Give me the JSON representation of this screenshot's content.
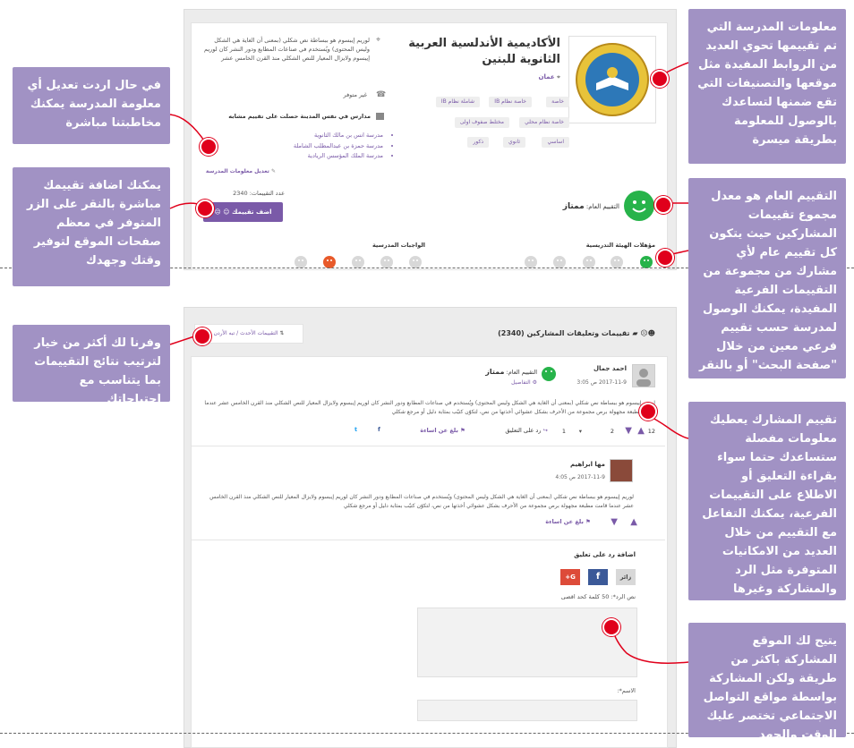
{
  "callouts": {
    "school_info": "معلومات المدرسة التي تم تقييمها تحوي العديد من الروابط المفيدة مثل موقعها والتصنيفات التي تقع ضمنها لتساعدك بالوصول للمعلومة بطريقة ميسرة",
    "overall_rating": "التقييم العام هو معدل مجموع تقييمات المشاركين حيث يتكون كل تقييم عام لأي مشارك من مجموعة من التقييمات الفرعية المفيدة، يمكنك الوصول لمدرسة حسب تقييم فرعي معين من خلال \"صفحة البحث\" أو بالنقر على \"تصفح\"",
    "participant_rating": "تقييم المشارك يعطيك معلومات مفصلة ستساعدك حتما سواء بقراءة التعليق أو الاطلاع على التقييمات الفرعية، يمكنك التفاعل مع التقييم من خلال العديد من الامكانيات المتوفرة مثل الرد والمشاركة وغيرها",
    "social_share": "يتيح لك الموقع المشاركة باكثر من طريقة ولكن المشاركة بواسطة مواقع التواصل الاجتماعي تختصر عليك الوقت والجهد",
    "edit_info": "في حال اردت تعديل أي معلومة المدرسة يمكنك مخاطبتنا مباشرة",
    "add_rating": "يمكنك اضافة تقييمك مباشرة بالنقر على الزر المتوفر في معظم صفحات الموقع لتوفير وقتك وجهدك",
    "sort": "وفرنا لك أكثر من خيار لترتيب نتائج التقييمات بما يتناسب مع احتياجاتك"
  },
  "school": {
    "name": "الأكاديمية الأندلسية العربية الثانوية للبنين",
    "location": "عمان",
    "tags_row1": [
      "خاصة",
      "خاصة نظام IB",
      "شاملة نظام IB"
    ],
    "tags_row2": [
      "خاصة نظام محلي",
      "مختلط صفوف اولى"
    ],
    "tags_row3": [
      "اساسي",
      "ثانوي",
      "ذكور"
    ],
    "description": "لوريم إيبسوم هو ببساطة نص شكلي (بمعنى أن الغاية هي الشكل وليس المحتوى) ويُستخدم في صناعات المطابع ودور النشر كان لوريم إيبسوم ولايزال المعيار للنص الشكلي منذ القرن الخامس عشر",
    "phone": "غير متوفر",
    "similar_title": "مدارس في نفس المدينة حصلت على تقييم مشابه",
    "similar": [
      "مدرسة انس بن مالك الثانوية",
      "مدرسة حمزة بن عبدالمطلب الشاملة",
      "مدرسة الملك المؤسس الريادية"
    ],
    "edit_link": "تعديل معلومات المدرسة",
    "overall_label": "التقييم العام:",
    "overall_value": "ممتاز",
    "ratings_count_label": "عدد التقييمات:",
    "ratings_count": "2340",
    "add_button": "اضف تقييمك",
    "sub1": "مؤهلات الهيئة التدريسية",
    "sub2": "الواجبات المدرسية"
  },
  "reviews": {
    "title": "تقييمات وتعليقات المشاركين",
    "count": "(2340)",
    "sort_label": "التقييمات الأحدث / تبه الأردن",
    "r1": {
      "author": "احمد جمال",
      "time": "2017-11-9 ص 3:05",
      "overall_label": "التقييم العام:",
      "overall_value": "ممتاز",
      "details": "التفاصيل",
      "text": "لوريم إيبسوم هو ببساطة نص شكلي (بمعنى أن الغاية هي الشكل وليس المحتوى) ويُستخدم في صناعات المطابع ودور النشر كان لوريم إيبسوم ولايزال المعيار للنص الشكلي منذ القرن الخامس عشر عندما قامت مطبعة مجهولة برص مجموعة من الأحرف بشكل عشوائي أخذتها من نص، لتكوّن كتيّب بمثابة دليل أو مرجع شكلي",
      "likes": "12",
      "dislikes": "2",
      "replies": "1",
      "reply_label": "رد على التعليق",
      "report_label": "بلغ عن اساءة"
    },
    "r2": {
      "author": "مها ابراهيم",
      "time": "2017-11-9 ص 4:05",
      "text": "لوريم إيبسوم هو ببساطة نص شكلي (بمعنى أن الغاية هي الشكل وليس المحتوى) ويُستخدم في صناعات المطابع ودور النشر كان لوريم إيبسوم ولايزال المعيار للنص الشكلي منذ القرن الخامس عشر عندما قامت مطبعة مجهولة برص مجموعة من الأحرف بشكل عشوائي أخذتها من نص، لتكوّن كتيّب بمثابة دليل أو مرجع شكلي",
      "report_label": "بلغ عن اساءة"
    },
    "add_reply_title": "اضافة رد على تعليق",
    "visitor": "زائر",
    "reply_text_label": "نص الرد*:",
    "reply_text_hint": "50 كلمة كحد اقصى",
    "name_label": "الاسم*:"
  }
}
